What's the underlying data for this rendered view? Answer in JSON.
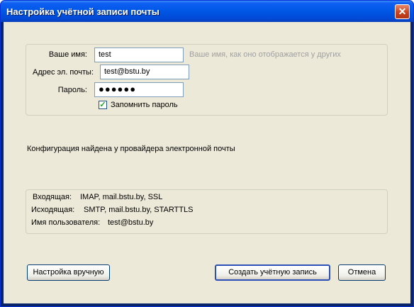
{
  "window": {
    "title": "Настройка учётной записи почты",
    "close_glyph": "✕"
  },
  "form": {
    "name_label": "Ваше имя:",
    "name_value": "test",
    "name_hint": "Ваше имя, как оно отображается у других",
    "email_label": "Адрес эл. почты:",
    "email_value": "test@bstu.by",
    "password_label": "Пароль:",
    "password_value": "●●●●●●",
    "remember_label": "Запомнить пароль",
    "remember_checked": true,
    "check_glyph": "✓"
  },
  "status": {
    "message": "Конфигурация найдена у провайдера электронной почты"
  },
  "config": {
    "incoming_label": "Входящая:",
    "incoming_value": "IMAP, mail.bstu.by, SSL",
    "outgoing_label": "Исходящая:",
    "outgoing_value": "SMTP, mail.bstu.by, STARTTLS",
    "username_label": "Имя пользователя:",
    "username_value": "test@bstu.by"
  },
  "buttons": {
    "manual": "Настройка вручную",
    "create": "Создать учётную запись",
    "cancel": "Отмена"
  },
  "colors": {
    "titlebar": "#0058e6",
    "dialog_bg": "#ece9d8",
    "hint_text": "#a0a0a0",
    "close_button": "#c8431f"
  }
}
